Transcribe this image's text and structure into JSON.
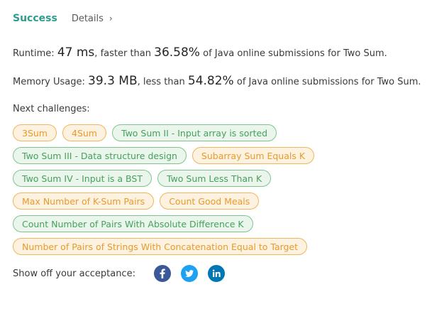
{
  "header": {
    "status": "Success",
    "details_label": "Details",
    "chevron_glyph": "›"
  },
  "runtime": {
    "label": "Runtime:",
    "value": "47 ms",
    "comparison": "faster than",
    "percent": "36.58%",
    "suffix": "of Java online submissions for Two Sum."
  },
  "memory": {
    "label": "Memory Usage:",
    "value": "39.3 MB",
    "comparison": "less than",
    "percent": "54.82%",
    "suffix": "of Java online submissions for Two Sum."
  },
  "next_challenges": {
    "label": "Next challenges:",
    "rows": [
      [
        {
          "label": "3Sum",
          "difficulty": "medium"
        },
        {
          "label": "4Sum",
          "difficulty": "medium"
        },
        {
          "label": "Two Sum II - Input array is sorted",
          "difficulty": "easy"
        }
      ],
      [
        {
          "label": "Two Sum III - Data structure design",
          "difficulty": "easy"
        },
        {
          "label": "Subarray Sum Equals K",
          "difficulty": "medium"
        }
      ],
      [
        {
          "label": "Two Sum IV - Input is a BST",
          "difficulty": "easy"
        },
        {
          "label": "Two Sum Less Than K",
          "difficulty": "easy"
        }
      ],
      [
        {
          "label": "Max Number of K-Sum Pairs",
          "difficulty": "medium"
        },
        {
          "label": "Count Good Meals",
          "difficulty": "medium"
        }
      ],
      [
        {
          "label": "Count Number of Pairs With Absolute Difference K",
          "difficulty": "easy"
        }
      ],
      [
        {
          "label": "Number of Pairs of Strings With Concatenation Equal to Target",
          "difficulty": "medium"
        }
      ]
    ]
  },
  "share": {
    "label": "Show off your acceptance:",
    "buttons": [
      {
        "icon": "facebook-icon",
        "glyph": "f"
      },
      {
        "icon": "twitter-icon",
        "glyph": ""
      },
      {
        "icon": "linkedin-icon",
        "glyph": "in"
      }
    ]
  },
  "colors": {
    "success": "#2e9c8e",
    "medium_text": "#e89b2c",
    "medium_bg": "#fdf1df",
    "easy_text": "#47a05c",
    "easy_bg": "#eaf6ec",
    "facebook": "#3b5998",
    "twitter": "#1da1f2",
    "linkedin": "#0077b5"
  }
}
